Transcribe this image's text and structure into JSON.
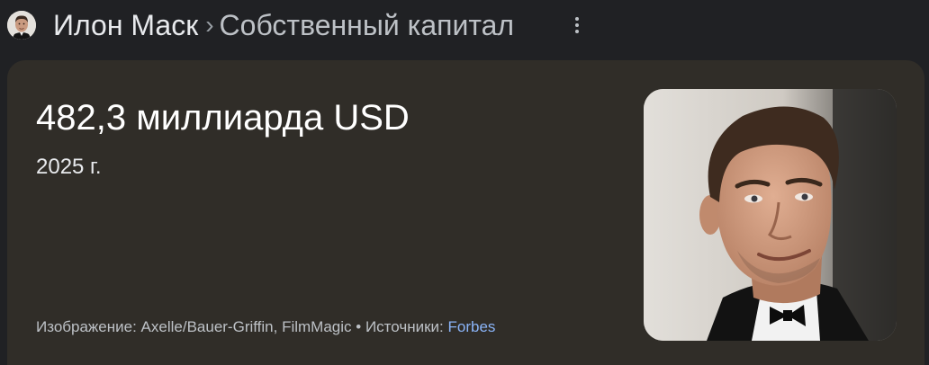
{
  "header": {
    "entity": "Илон Маск",
    "separator": "›",
    "attribute": "Собственный капитал"
  },
  "answer": {
    "value": "482,3 миллиарда USD",
    "date": "2025 г."
  },
  "credits": {
    "image_prefix": "Изображение:",
    "image_credit": "Axelle/Bauer-Griffin, FilmMagic",
    "bullet": "•",
    "sources_prefix": "Источники:",
    "source_link": "Forbes"
  },
  "icons": {
    "menu": "more-vert-icon",
    "avatar": "person-avatar",
    "photo": "person-photo"
  },
  "colors": {
    "page_bg": "#202124",
    "card_bg": "#302d28",
    "link": "#8ab4f8"
  }
}
